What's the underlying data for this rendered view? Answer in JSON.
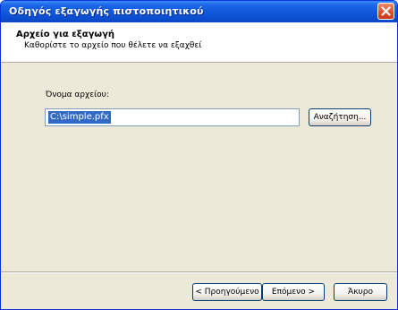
{
  "window": {
    "title": "Οδηγός εξαγωγής πιστοποιητικού"
  },
  "header": {
    "title": "Αρχείο για εξαγωγή",
    "subtitle": "Καθορίστε το αρχείο που θέλετε να εξαχθεί"
  },
  "form": {
    "file_label": "Όνομα αρχείου:",
    "file_value": "C:\\simple.pfx",
    "browse_label": "Αναζήτηση..."
  },
  "footer": {
    "back_label": "< Προηγούμενο",
    "next_label": "Επόμενο >",
    "cancel_label": "Άκυρο"
  },
  "colors": {
    "titlebar": "#0f55d8",
    "close": "#e0502a",
    "selection": "#316ac5",
    "dialog_bg": "#ece9d8"
  },
  "icons": {
    "close": "close-icon"
  }
}
